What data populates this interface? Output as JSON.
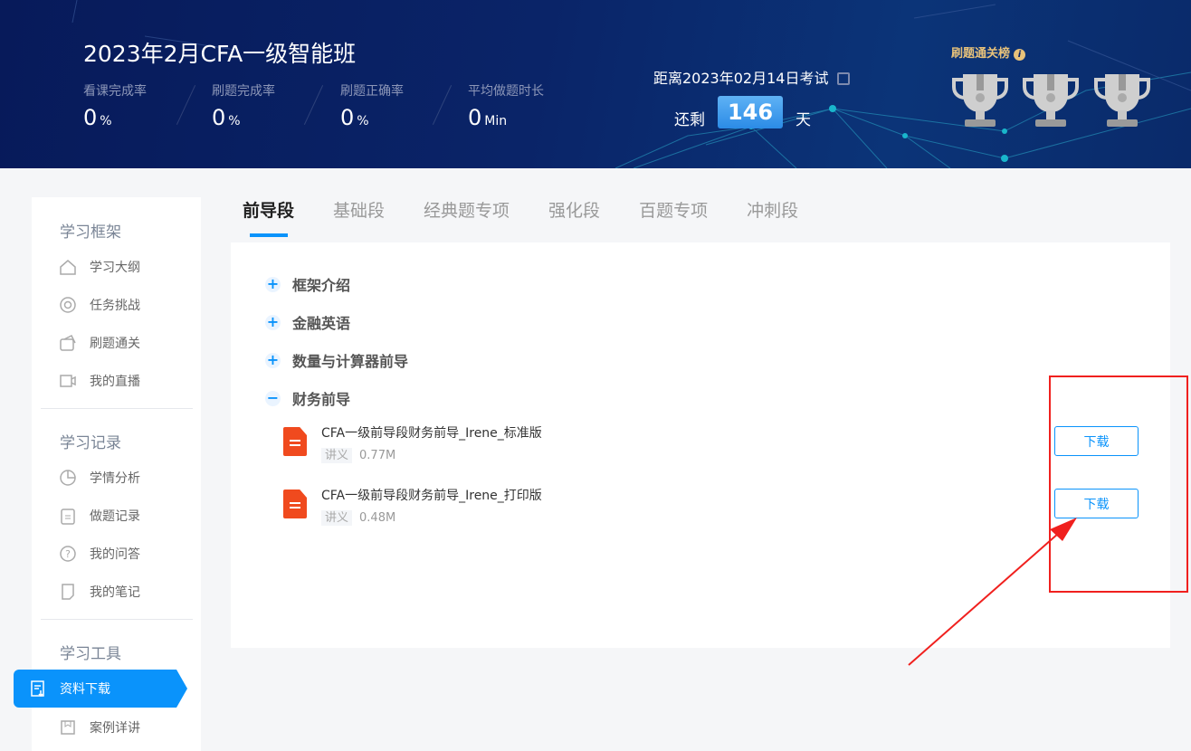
{
  "header": {
    "course_title": "2023年2月CFA一级智能班",
    "stats": [
      {
        "label": "看课完成率",
        "value": "0",
        "unit": "%"
      },
      {
        "label": "刷题完成率",
        "value": "0",
        "unit": "%"
      },
      {
        "label": "刷题正确率",
        "value": "0",
        "unit": "%"
      },
      {
        "label": "平均做题时长",
        "value": "0",
        "unit": "Min"
      }
    ],
    "exam_text": "距离2023年02月14日考试",
    "remain_label": "还剩",
    "days": "146",
    "day_unit": "天",
    "rank_title": "刷题通关榜",
    "info_icon": "i"
  },
  "sidebar": {
    "sections": [
      {
        "title": "学习框架",
        "items": [
          "学习大纲",
          "任务挑战",
          "刷题通关",
          "我的直播"
        ]
      },
      {
        "title": "学习记录",
        "items": [
          "学情分析",
          "做题记录",
          "我的问答",
          "我的笔记"
        ]
      },
      {
        "title": "学习工具",
        "items": [
          "资料下载",
          "案例详讲"
        ]
      }
    ],
    "active": "资料下载"
  },
  "tabs": [
    "前导段",
    "基础段",
    "经典题专项",
    "强化段",
    "百题专项",
    "冲刺段"
  ],
  "accordion": [
    {
      "label": "框架介绍",
      "expanded": false,
      "sign": "+"
    },
    {
      "label": "金融英语",
      "expanded": false,
      "sign": "+"
    },
    {
      "label": "数量与计算器前导",
      "expanded": false,
      "sign": "+"
    },
    {
      "label": "财务前导",
      "expanded": true,
      "sign": "−"
    }
  ],
  "files": [
    {
      "name": "CFA一级前导段财务前导_Irene_标准版",
      "tag": "讲义",
      "size": "0.77M",
      "button": "下载"
    },
    {
      "name": "CFA一级前导段财务前导_Irene_打印版",
      "tag": "讲义",
      "size": "0.48M",
      "button": "下载"
    }
  ],
  "colors": {
    "accent": "#0a93fb",
    "file_icon": "#f04a1e",
    "annotation": "#f0201e"
  }
}
